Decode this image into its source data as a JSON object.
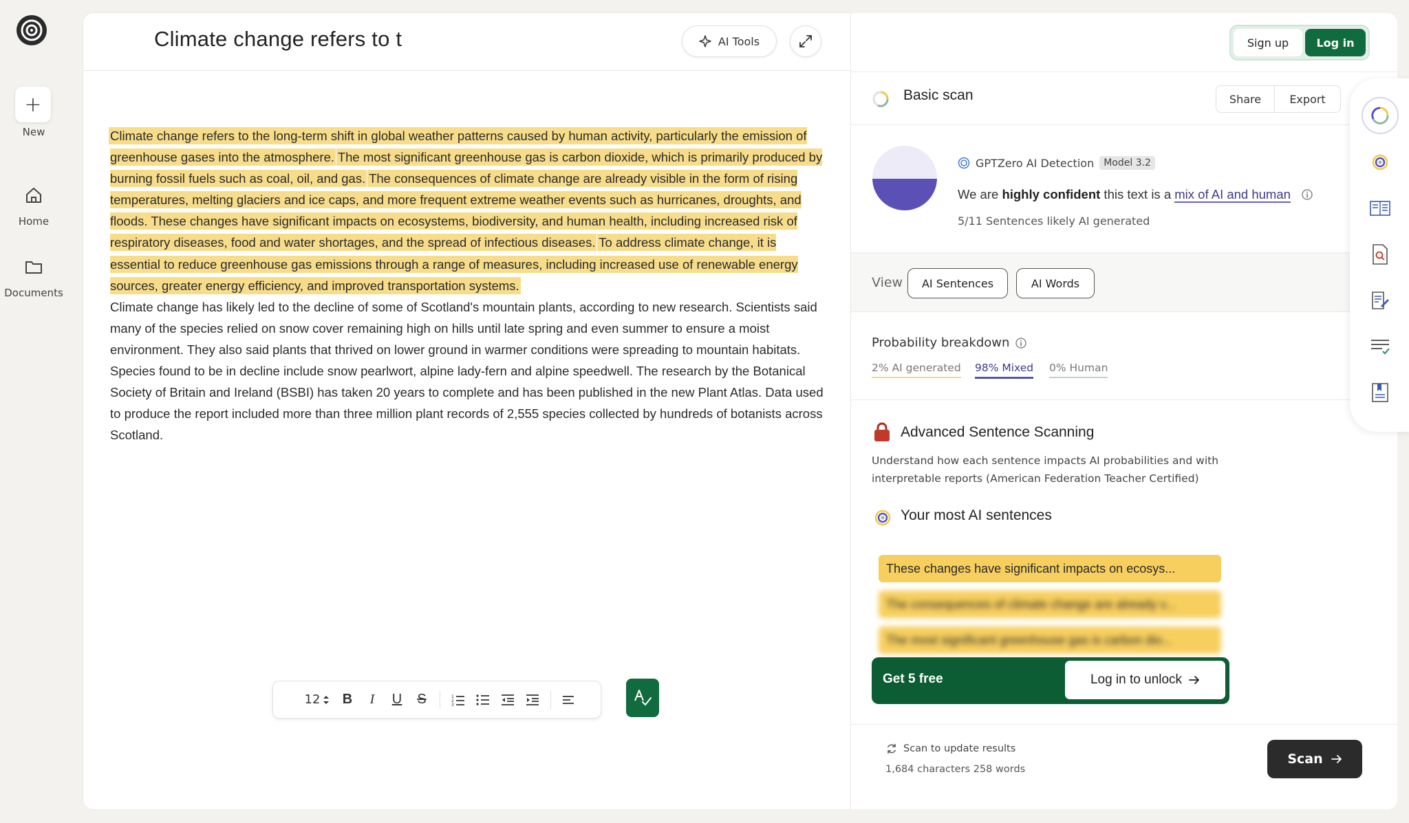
{
  "rail": {
    "new_label": "New",
    "home_label": "Home",
    "documents_label": "Documents"
  },
  "editor": {
    "title": "Climate change refers to t",
    "ai_tools_label": "AI Tools",
    "highlighted_sentences": [
      "Climate change refers to the long-term shift in global weather patterns caused by human activity, particularly the emission of greenhouse gases into the atmosphere.",
      "The most significant greenhouse gas is carbon dioxide, which is primarily produced by burning fossil fuels such as coal, oil, and gas.",
      "The consequences of climate change are already visible in the form of rising temperatures, melting glaciers and ice caps, and more frequent extreme weather events such as hurricanes, droughts, and floods.",
      "These changes have significant impacts on ecosystems, biodiversity, and human health, including increased risk of respiratory diseases, food and water shortages, and the spread of infectious diseases.",
      "To address climate change, it is essential to reduce greenhouse gas emissions through a range of measures, including increased use of renewable energy sources, greater energy efficiency, and improved transportation systems."
    ],
    "plain_paragraph": "Climate change has likely led to the decline of some of Scotland's mountain plants, according to new research. Scientists said many of the species relied on snow cover remaining high on hills until late spring and even summer to ensure a moist environment. They also said plants that thrived on lower ground in warmer conditions were spreading to mountain habitats. Species found to be in decline include snow pearlwort, alpine lady-fern and alpine speedwell. The research by the Botanical Society of Britain and Ireland (BSBI) has taken 20 years to complete and has been published in the new Plant Atlas. Data used to produce the report included more than three million plant records of 2,555 species collected by hundreds of botanists across Scotland.",
    "font_size": "12",
    "highlight_color": "#f7dc8a"
  },
  "auth": {
    "signup_label": "Sign up",
    "login_label": "Log in"
  },
  "scan": {
    "title": "Basic scan",
    "share_label": "Share",
    "export_label": "Export",
    "detector_label": "GPTZero AI Detection",
    "model_badge": "Model 3.2",
    "confidence_prefix": "We are ",
    "confidence_strong": "highly confident",
    "confidence_middle": " this text is a ",
    "confidence_link": "mix of AI and human",
    "sentence_summary": "5/11 Sentences likely AI generated",
    "gauge_mixed_fraction": 0.98,
    "view_label": "View",
    "view_ai_sentences": "AI Sentences",
    "view_ai_words": "AI Words",
    "probability_title": "Probability breakdown",
    "prob_ai": "2% AI generated",
    "prob_mixed": "98% Mixed",
    "prob_human": "0% Human",
    "advanced_title": "Advanced Sentence Scanning",
    "advanced_desc": "Understand how each sentence impacts AI probabilities and with interpretable reports (American Federation Teacher Certified)",
    "most_ai_title": "Your most AI sentences",
    "top_sentences": [
      "These changes have significant impacts on ecosys...",
      "The consequences of climate change are already v...",
      "The most significant greenhouse gas is carbon dio..."
    ],
    "get_free_label": "Get 5 free",
    "unlock_label": "Log in to unlock",
    "update_label": "Scan to update results",
    "counts_label": "1,684 characters 258 words",
    "scan_button_label": "Scan"
  },
  "colors": {
    "brand_green": "#106b3e",
    "mixed_purple": "#5b50b5",
    "ai_yellow": "#f2c94c",
    "human_teal": "#8fb8a8"
  }
}
